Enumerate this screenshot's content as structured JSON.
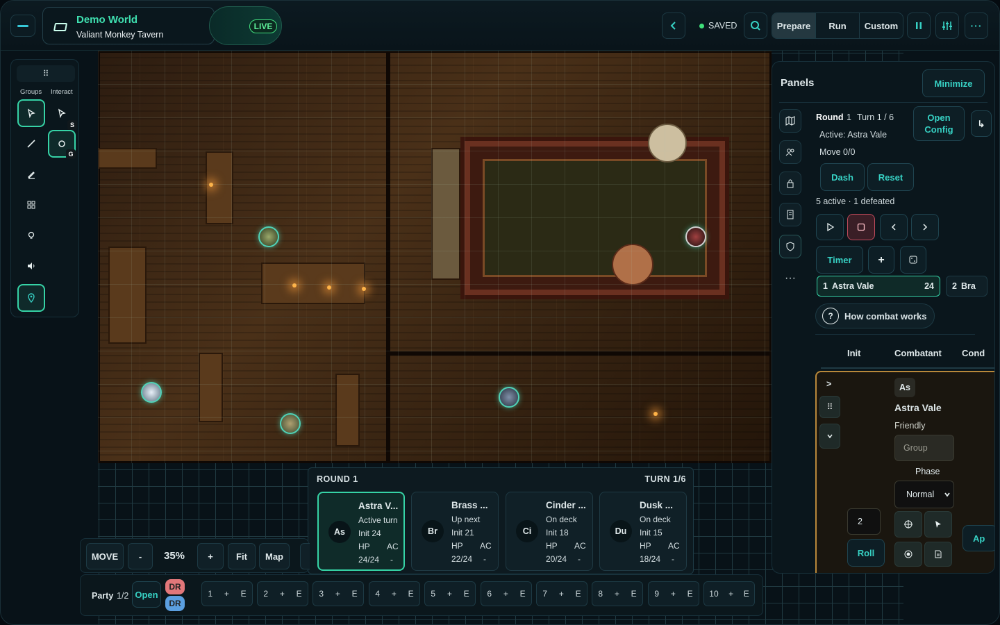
{
  "header": {
    "world_title": "Demo World",
    "world_subtitle": "Valiant Monkey Tavern",
    "live_badge": "LIVE",
    "saved_label": "SAVED",
    "modes": [
      "Prepare",
      "Run",
      "Custom"
    ],
    "active_mode": "Prepare"
  },
  "toolbar": {
    "groups_label": "Groups",
    "interact_label": "Interact",
    "select_shortcut": "S",
    "group_shortcut": "G"
  },
  "panels": {
    "title": "Panels",
    "minimize_label": "Minimize",
    "round_label": "Round",
    "round_value": "1",
    "turn_label": "Turn 1 / 6",
    "active_label": "Active: Astra Vale",
    "move_label": "Move 0/0",
    "open_config_line1": "Open",
    "open_config_line2": "Config",
    "dash_label": "Dash",
    "reset_label": "Reset",
    "status_summary": "5 active · 1 defeated",
    "timer_label": "Timer",
    "turn_cards": [
      {
        "index": "1",
        "name": "Astra Vale",
        "init": "24"
      },
      {
        "index": "2",
        "name": "Bra"
      }
    ],
    "help_label": "How combat works",
    "columns": [
      "Init",
      "Combatant",
      "Cond"
    ],
    "entry": {
      "expand": ">",
      "abbr": "As",
      "name": "Astra Vale",
      "disposition": "Friendly",
      "group_placeholder": "Group",
      "phase_label": "Phase",
      "phase_value": "Normal",
      "init_value": "2",
      "roll_label": "Roll",
      "apply_partial": "Ap"
    }
  },
  "tracker": {
    "round": "ROUND 1",
    "turn": "TURN 1/6",
    "combatants": [
      {
        "abbr": "As",
        "name": "Astra V...",
        "status": "Active turn",
        "init": "Init 24",
        "hp_label": "HP",
        "ac_label": "AC",
        "hp": "24/24",
        "ac": "-",
        "active": true
      },
      {
        "abbr": "Br",
        "name": "Brass ...",
        "status": "Up next",
        "init": "Init 21",
        "hp_label": "HP",
        "ac_label": "AC",
        "hp": "22/24",
        "ac": "-",
        "active": false
      },
      {
        "abbr": "Ci",
        "name": "Cinder ...",
        "status": "On deck",
        "init": "Init 18",
        "hp_label": "HP",
        "ac_label": "AC",
        "hp": "20/24",
        "ac": "-",
        "active": false
      },
      {
        "abbr": "Du",
        "name": "Dusk ...",
        "status": "On deck",
        "init": "Init 15",
        "hp_label": "HP",
        "ac_label": "AC",
        "hp": "18/24",
        "ac": "-",
        "active": false
      }
    ]
  },
  "movebar": {
    "move_label": "MOVE",
    "zoom_out": "-",
    "zoom": "35%",
    "zoom_in": "+",
    "fit_label": "Fit",
    "map_label": "Map"
  },
  "party": {
    "label": "Party",
    "count": "1/2",
    "open_label": "Open",
    "badge_top": "DR",
    "badge_bottom": "DR",
    "slots": [
      {
        "n": "1",
        "plus": "+",
        "e": "E"
      },
      {
        "n": "2",
        "plus": "+",
        "e": "E"
      },
      {
        "n": "3",
        "plus": "+",
        "e": "E"
      },
      {
        "n": "4",
        "plus": "+",
        "e": "E"
      },
      {
        "n": "5",
        "plus": "+",
        "e": "E"
      },
      {
        "n": "6",
        "plus": "+",
        "e": "E"
      },
      {
        "n": "7",
        "plus": "+",
        "e": "E"
      },
      {
        "n": "8",
        "plus": "+",
        "e": "E"
      },
      {
        "n": "9",
        "plus": "+",
        "e": "E"
      },
      {
        "n": "10",
        "plus": "+",
        "e": "E"
      }
    ]
  },
  "colors": {
    "accent": "#37d1c4",
    "live_green": "#43e07f",
    "active_border": "#36d3a6",
    "badge_red": "#e2777a",
    "badge_blue": "#5b9fe0"
  },
  "icons": [
    "menu-dash-icon",
    "map-icon",
    "chevron-left-icon",
    "search-icon",
    "pause-icon",
    "sliders-icon",
    "more-icon",
    "select-arrow-icon",
    "brush-icon",
    "pen-icon",
    "grid-icon",
    "bulb-icon",
    "speaker-icon",
    "pin-icon",
    "users-icon",
    "lock-icon",
    "book-icon",
    "shield-icon",
    "play-icon",
    "stop-icon",
    "next-icon",
    "prev-icon",
    "plus-icon",
    "dice-icon",
    "question-icon",
    "crosshair-icon",
    "cursor-icon",
    "record-icon",
    "note-icon"
  ]
}
